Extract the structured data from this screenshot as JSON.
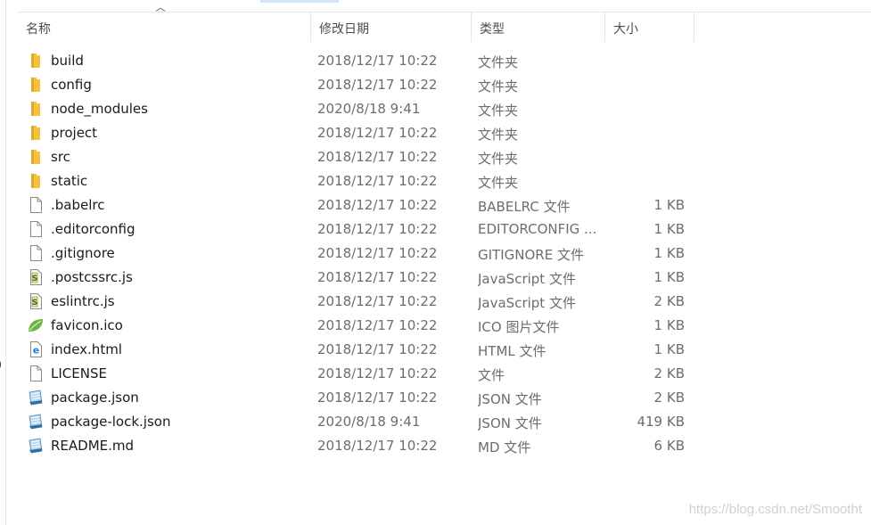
{
  "columns": {
    "name": "名称",
    "date": "修改日期",
    "type": "类型",
    "size": "大小"
  },
  "files": [
    {
      "name": "build",
      "date": "2018/12/17 10:22",
      "type": "文件夹",
      "size": "",
      "icon": "folder-icon"
    },
    {
      "name": "config",
      "date": "2018/12/17 10:22",
      "type": "文件夹",
      "size": "",
      "icon": "folder-icon"
    },
    {
      "name": "node_modules",
      "date": "2020/8/18 9:41",
      "type": "文件夹",
      "size": "",
      "icon": "folder-icon"
    },
    {
      "name": "project",
      "date": "2018/12/17 10:22",
      "type": "文件夹",
      "size": "",
      "icon": "folder-icon"
    },
    {
      "name": "src",
      "date": "2018/12/17 10:22",
      "type": "文件夹",
      "size": "",
      "icon": "folder-icon"
    },
    {
      "name": "static",
      "date": "2018/12/17 10:22",
      "type": "文件夹",
      "size": "",
      "icon": "folder-icon"
    },
    {
      "name": ".babelrc",
      "date": "2018/12/17 10:22",
      "type": "BABELRC 文件",
      "size": "1 KB",
      "icon": "blank-file-icon"
    },
    {
      "name": ".editorconfig",
      "date": "2018/12/17 10:22",
      "type": "EDITORCONFIG ...",
      "size": "1 KB",
      "icon": "blank-file-icon"
    },
    {
      "name": ".gitignore",
      "date": "2018/12/17 10:22",
      "type": "GITIGNORE 文件",
      "size": "1 KB",
      "icon": "blank-file-icon"
    },
    {
      "name": ".postcssrc.js",
      "date": "2018/12/17 10:22",
      "type": "JavaScript 文件",
      "size": "1 KB",
      "icon": "script-file-icon"
    },
    {
      "name": "eslintrc.js",
      "date": "2018/12/17 10:22",
      "type": "JavaScript 文件",
      "size": "2 KB",
      "icon": "script-file-icon"
    },
    {
      "name": "favicon.ico",
      "date": "2018/12/17 10:22",
      "type": "ICO 图片文件",
      "size": "1 KB",
      "icon": "leaf-icon"
    },
    {
      "name": "index.html",
      "date": "2018/12/17 10:22",
      "type": "HTML 文件",
      "size": "1 KB",
      "icon": "html-file-icon"
    },
    {
      "name": "LICENSE",
      "date": "2018/12/17 10:22",
      "type": "文件",
      "size": "2 KB",
      "icon": "blank-file-icon"
    },
    {
      "name": "package.json",
      "date": "2018/12/17 10:22",
      "type": "JSON 文件",
      "size": "2 KB",
      "icon": "json-file-icon"
    },
    {
      "name": "package-lock.json",
      "date": "2020/8/18 9:41",
      "type": "JSON 文件",
      "size": "419 KB",
      "icon": "json-file-icon"
    },
    {
      "name": "README.md",
      "date": "2018/12/17 10:22",
      "type": "MD 文件",
      "size": "6 KB",
      "icon": "json-file-icon"
    }
  ],
  "watermark": "https://blog.csdn.net/Smootht",
  "colors": {
    "folder": "#f5c33b",
    "header_text": "#4d4d4d",
    "meta_text": "#6d6d6d",
    "ie_blue": "#1f7fd8",
    "leaf_green": "#6db33f"
  }
}
